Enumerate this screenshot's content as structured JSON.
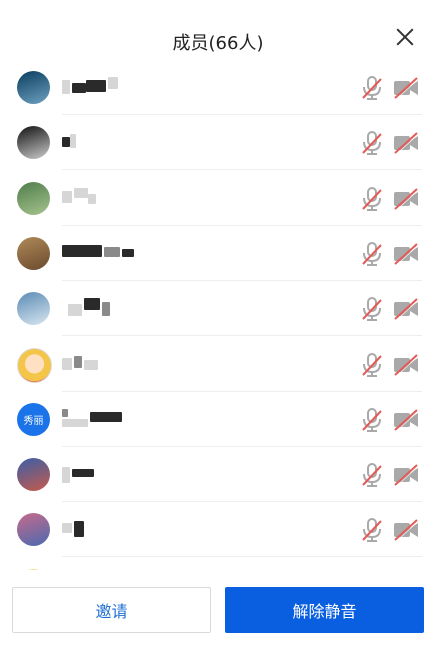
{
  "header": {
    "title": "成员(66人)"
  },
  "members": [
    {
      "avatar_icon": "photo-avatar",
      "avatar_colors": [
        "#0b3e5e",
        "#6ea0c0"
      ],
      "name_masked": true
    },
    {
      "avatar_icon": "photo-avatar",
      "avatar_colors": [
        "#111111",
        "#cccccc"
      ],
      "name_masked": true
    },
    {
      "avatar_icon": "photo-avatar",
      "avatar_colors": [
        "#4f7c4a",
        "#a6c48e"
      ],
      "name_masked": true
    },
    {
      "avatar_icon": "photo-avatar",
      "avatar_colors": [
        "#b08a58",
        "#6a4a2e"
      ],
      "name_masked": true
    },
    {
      "avatar_icon": "photo-avatar",
      "avatar_colors": [
        "#5b8bb4",
        "#d8e6f0"
      ],
      "name_masked": true
    },
    {
      "avatar_icon": "cartoon-avatar",
      "avatar_colors": [
        "#f3c64a",
        "#e85d4a"
      ],
      "name_masked": true
    },
    {
      "avatar_icon": "text-avatar",
      "avatar_text": "秀丽",
      "avatar_colors": [
        "#1a73e8",
        "#1a73e8"
      ],
      "name_masked": true
    },
    {
      "avatar_icon": "photo-avatar",
      "avatar_colors": [
        "#3a5fa8",
        "#c65a4a"
      ],
      "name_masked": true
    },
    {
      "avatar_icon": "photo-avatar",
      "avatar_colors": [
        "#c86a8a",
        "#4a6ab0"
      ],
      "name_masked": true
    },
    {
      "avatar_icon": "photo-avatar",
      "avatar_colors": [
        "#e9c54a",
        "#f5e08a"
      ],
      "name_masked": true
    }
  ],
  "member_status": {
    "mic": "muted-mic-icon",
    "camera": "camera-off-icon"
  },
  "colors": {
    "muted_icon": "#a9a9a9",
    "slash": "#e35b58",
    "primary": "#0a5fe0",
    "invite_text": "#1f6fd1"
  },
  "footer": {
    "invite_label": "邀请",
    "unmute_all_label": "解除静音"
  }
}
